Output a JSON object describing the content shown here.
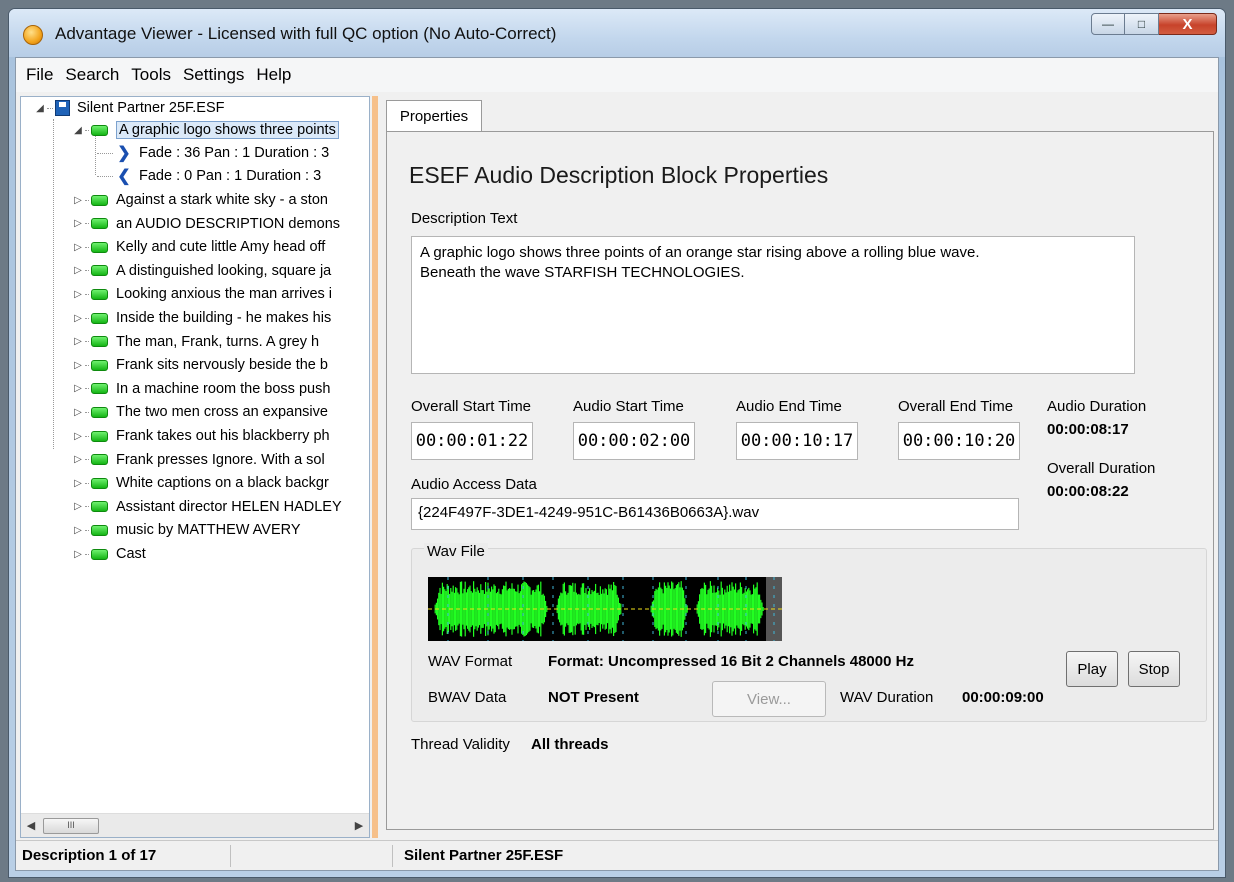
{
  "window": {
    "title": "Advantage Viewer - Licensed with full QC option (No Auto-Correct)",
    "minimize_glyph": "—",
    "maximize_glyph": "□",
    "close_glyph": "X"
  },
  "menu": [
    "File",
    "Search",
    "Tools",
    "Settings",
    "Help"
  ],
  "tree": {
    "root": "Silent Partner 25F.ESF",
    "selected_item": "A graphic logo shows three points",
    "sub_items": [
      {
        "label": "Fade : 36 Pan : 1 Duration : 3",
        "arrow": "❯"
      },
      {
        "label": "Fade : 0 Pan : 1 Duration : 3",
        "arrow": "❮"
      }
    ],
    "items": [
      "Against a stark white sky - a ston",
      "an AUDIO DESCRIPTION demons",
      "Kelly and cute little Amy head off",
      "A distinguished looking, square ja",
      "Looking anxious the man arrives i",
      "Inside the building - he makes his",
      "The man, Frank, turns.  A grey h",
      "Frank sits nervously beside the b",
      "In a machine room the boss push",
      "The two men cross an expansive",
      "Frank takes out his blackberry ph",
      "Frank presses Ignore.  With a sol",
      "White captions on a black backgr",
      "Assistant director HELEN HADLEY",
      "music by MATTHEW AVERY",
      "Cast"
    ],
    "scroll_thumb_glyph": "III"
  },
  "tab": {
    "label": "Properties"
  },
  "properties": {
    "heading": "ESEF Audio Description Block Properties",
    "description_label": "Description Text",
    "description_line1": "A graphic logo shows three points of an orange star rising  above a rolling blue wave.",
    "description_line2": "Beneath the wave STARFISH TECHNOLOGIES.",
    "overall_start_label": "Overall Start Time",
    "overall_start": "00:00:01:22",
    "audio_start_label": "Audio Start Time",
    "audio_start": "00:00:02:00",
    "audio_end_label": "Audio End Time",
    "audio_end": "00:00:10:17",
    "overall_end_label": "Overall End Time",
    "overall_end": "00:00:10:20",
    "audio_duration_label": "Audio Duration",
    "audio_duration": "00:00:08:17",
    "overall_duration_label": "Overall Duration",
    "overall_duration": "00:00:08:22",
    "access_label": "Audio Access Data",
    "access_value": "{224F497F-3DE1-4249-951C-B61436B0663A}.wav",
    "wav_group_title": "Wav File",
    "wav_format_label": "WAV Format",
    "wav_format": "Format: Uncompressed 16 Bit 2 Channels 48000 Hz",
    "bwav_label": "BWAV Data",
    "bwav_value": "NOT Present",
    "view_button": "View...",
    "wav_duration_label": "WAV Duration",
    "wav_duration": "00:00:09:00",
    "play_button": "Play",
    "stop_button": "Stop",
    "thread_label": "Thread Validity",
    "thread_value": "All threads"
  },
  "status": {
    "left": "Description 1 of 17",
    "right": "Silent Partner 25F.ESF"
  },
  "colors": {
    "waveform": "#22ff22",
    "wave_background": "#000000",
    "splitter": "#f6c08a",
    "tree_icon": "#22c322"
  }
}
